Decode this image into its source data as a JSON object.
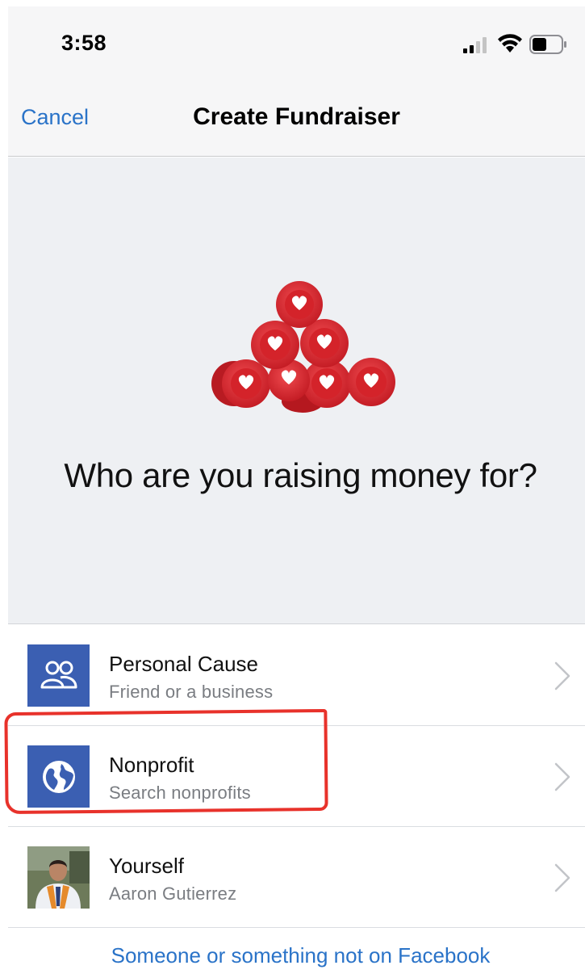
{
  "status_bar": {
    "time": "3:58",
    "icons": [
      "cellular-signal-icon",
      "wifi-icon",
      "battery-icon"
    ]
  },
  "nav": {
    "cancel_label": "Cancel",
    "title": "Create Fundraiser"
  },
  "hero": {
    "illustration": "heart-tokens-pile-icon",
    "question": "Who are you raising money for?"
  },
  "options": [
    {
      "title": "Personal Cause",
      "subtitle": "Friend or a business",
      "icon": "people-icon"
    },
    {
      "title": "Nonprofit",
      "subtitle": "Search nonprofits",
      "icon": "globe-icon"
    },
    {
      "title": "Yourself",
      "subtitle": "Aaron Gutierrez",
      "icon": "profile-photo"
    }
  ],
  "footer": {
    "link_label": "Someone or something not on Facebook"
  },
  "colors": {
    "accent_blue": "#2a73c8",
    "icon_tile_blue": "#3b5fb2",
    "highlight_red": "#e8322b",
    "token_red": "#d9262c"
  }
}
